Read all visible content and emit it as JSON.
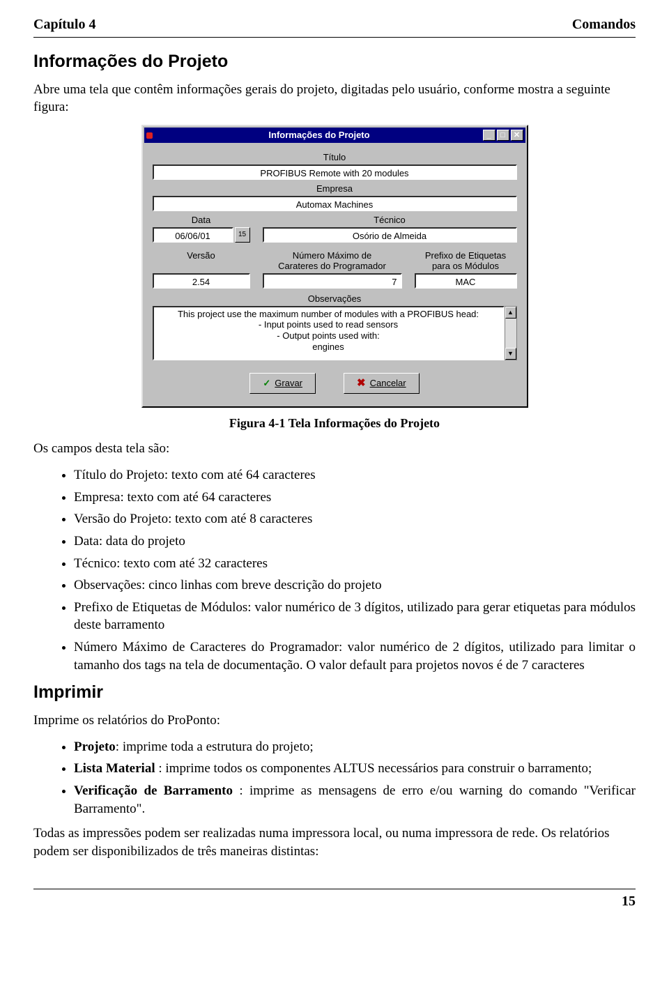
{
  "header": {
    "left": "Capítulo 4",
    "right": "Comandos"
  },
  "section1": {
    "title": "Informações do Projeto",
    "intro": "Abre uma tela que contêm informações gerais do projeto, digitadas pelo usuário, conforme mostra a seguinte figura:"
  },
  "window": {
    "title": "Informações do Projeto",
    "labels": {
      "titulo": "Título",
      "empresa": "Empresa",
      "data": "Data",
      "tecnico": "Técnico",
      "versao": "Versão",
      "numMaxCar": "Número Máximo de\nCarateres do Programador",
      "prefixo": "Prefixo de Etiquetas\npara os Módulos",
      "observ": "Observações"
    },
    "values": {
      "titulo": "PROFIBUS Remote with 20 modules",
      "empresa": "Automax Machines",
      "data": "06/06/01",
      "tecnico": "Osório de Almeida",
      "versao": "2.54",
      "numMaxCar": "7",
      "prefixo": "MAC",
      "observ": "This project use the maximum number of modules with a PROFIBUS head:\n- Input points used to read sensors\n- Output points used with:\nengines"
    },
    "buttons": {
      "gravar": "Gravar",
      "cancelar": "Cancelar"
    },
    "date_icon": "15"
  },
  "caption": "Figura 4-1 Tela Informações do Projeto",
  "fields_intro": "Os campos desta tela são:",
  "field_bullets": [
    "Título do Projeto: texto com até 64 caracteres",
    "Empresa: texto com até 64 caracteres",
    "Versão do Projeto: texto com até 8 caracteres",
    "Data: data do projeto",
    "Técnico: texto com até 32 caracteres",
    "Observações: cinco linhas com breve descrição do projeto",
    "Prefixo de Etiquetas de Módulos: valor numérico de 3 dígitos, utilizado para gerar etiquetas para módulos deste barramento",
    "Número Máximo de Caracteres do Programador: valor numérico de 2 dígitos, utilizado para limitar o tamanho dos tags na tela de documentação. O valor default para projetos novos é de 7 caracteres"
  ],
  "section2": {
    "title": "Imprimir",
    "intro": "Imprime os relatórios do ProPonto:",
    "items": [
      {
        "bold": "Projeto",
        "rest": ": imprime toda a estrutura do projeto;"
      },
      {
        "bold": "Lista Material ",
        "rest": ": imprime todos os componentes ALTUS necessários para construir o barramento;"
      },
      {
        "bold": "Verificação de Barramento ",
        "rest": ": imprime as mensagens de erro e/ou warning do comando \"Verificar Barramento\"."
      }
    ],
    "outro": "Todas as impressões podem ser realizadas numa impressora local, ou numa impressora de rede. Os relatórios podem ser disponibilizados de três maneiras distintas:"
  },
  "page_number": "15"
}
